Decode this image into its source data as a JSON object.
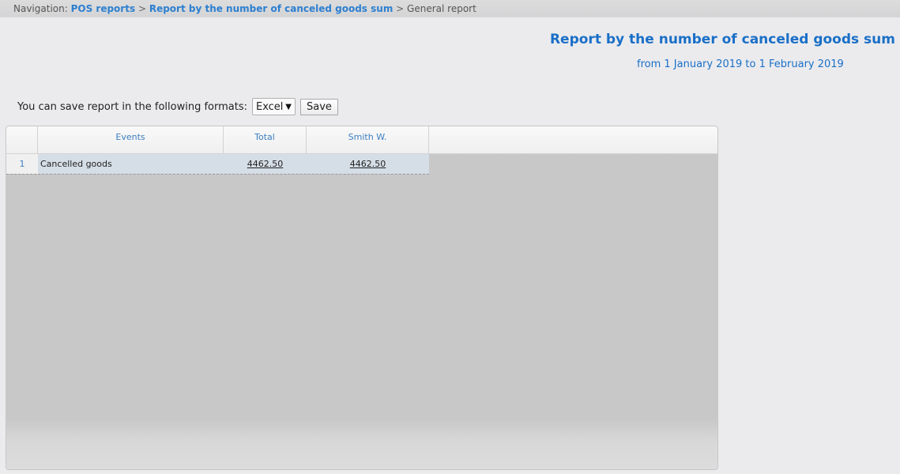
{
  "breadcrumb": {
    "prefix": "Navigation:",
    "link1": "POS reports",
    "sep1": ">",
    "link2": "Report by the number of canceled goods sum",
    "sep2": ">",
    "current": "General report"
  },
  "report": {
    "title": "Report by the number of canceled goods sum",
    "period": "from 1 January 2019 to 1 February 2019"
  },
  "save": {
    "label": "You can save report in the following formats:",
    "format": "Excel",
    "button": "Save"
  },
  "table": {
    "headers": {
      "num": "",
      "events": "Events",
      "total": "Total",
      "smith": "Smith W."
    },
    "rows": [
      {
        "num": "1",
        "event": "Cancelled goods",
        "total": "4462.50",
        "smith": "4462.50"
      }
    ]
  },
  "colors": {
    "link": "#2c7fd0",
    "title": "#1a6fc7",
    "row_selected": "#d5dde6",
    "grid_body": "#c8c8c8"
  },
  "icons": {
    "dropdown": "caret-down-icon"
  }
}
